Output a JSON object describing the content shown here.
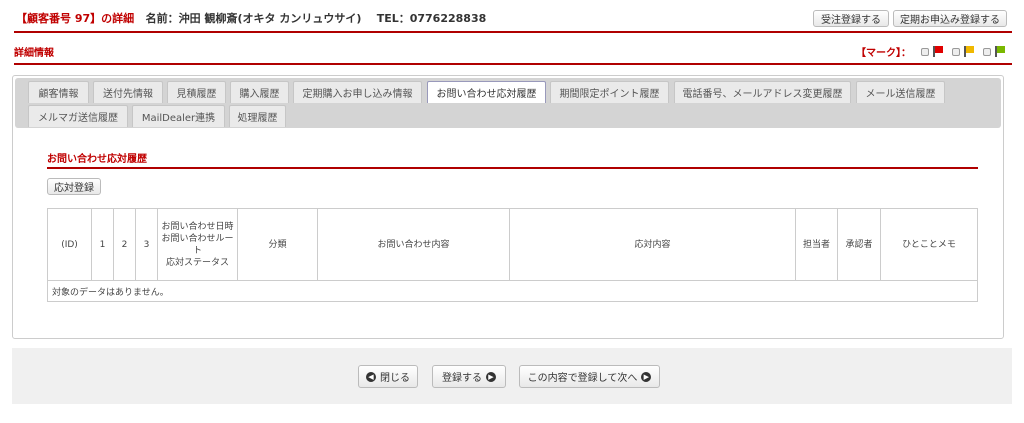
{
  "header": {
    "customer_no": "【顧客番号 97】の詳細",
    "name": "名前：沖田 観柳斎(オキタ カンリュウサイ)",
    "tel": "TEL：0776228838"
  },
  "top_buttons": {
    "order": "受注登録する",
    "subscription": "定期お申込み登録する"
  },
  "section_title": "詳細情報",
  "mark": {
    "label": "【マーク】：",
    "flags": [
      {
        "color": "#e00000"
      },
      {
        "color": "#f0b800"
      },
      {
        "color": "#7ab800"
      }
    ]
  },
  "tabs_row1": [
    "顧客情報",
    "送付先情報",
    "見積履歴",
    "購入履歴",
    "定期購入お申し込み情報",
    "お問い合わせ応対履歴",
    "期間限定ポイント履歴",
    "電話番号、メールアドレス変更履歴",
    "メール送信履歴"
  ],
  "tabs_row2": [
    "メルマガ送信履歴",
    "MailDealer連携",
    "処理履歴"
  ],
  "active_tab": "お問い合わせ応対履歴",
  "panel": {
    "title": "お問い合わせ応対履歴",
    "register_button": "応対登録",
    "columns": [
      "(ID)",
      "1",
      "2",
      "3",
      "お問い合わせ日時",
      "お問い合わせルート",
      "応対ステータス",
      "分類",
      "お問い合わせ内容",
      "応対内容",
      "担当者",
      "承認者",
      "ひとことメモ"
    ],
    "empty": "対象のデータはありません。"
  },
  "footer": {
    "close": "閉じる",
    "register": "登録する",
    "register_next": "この内容で登録して次へ"
  }
}
